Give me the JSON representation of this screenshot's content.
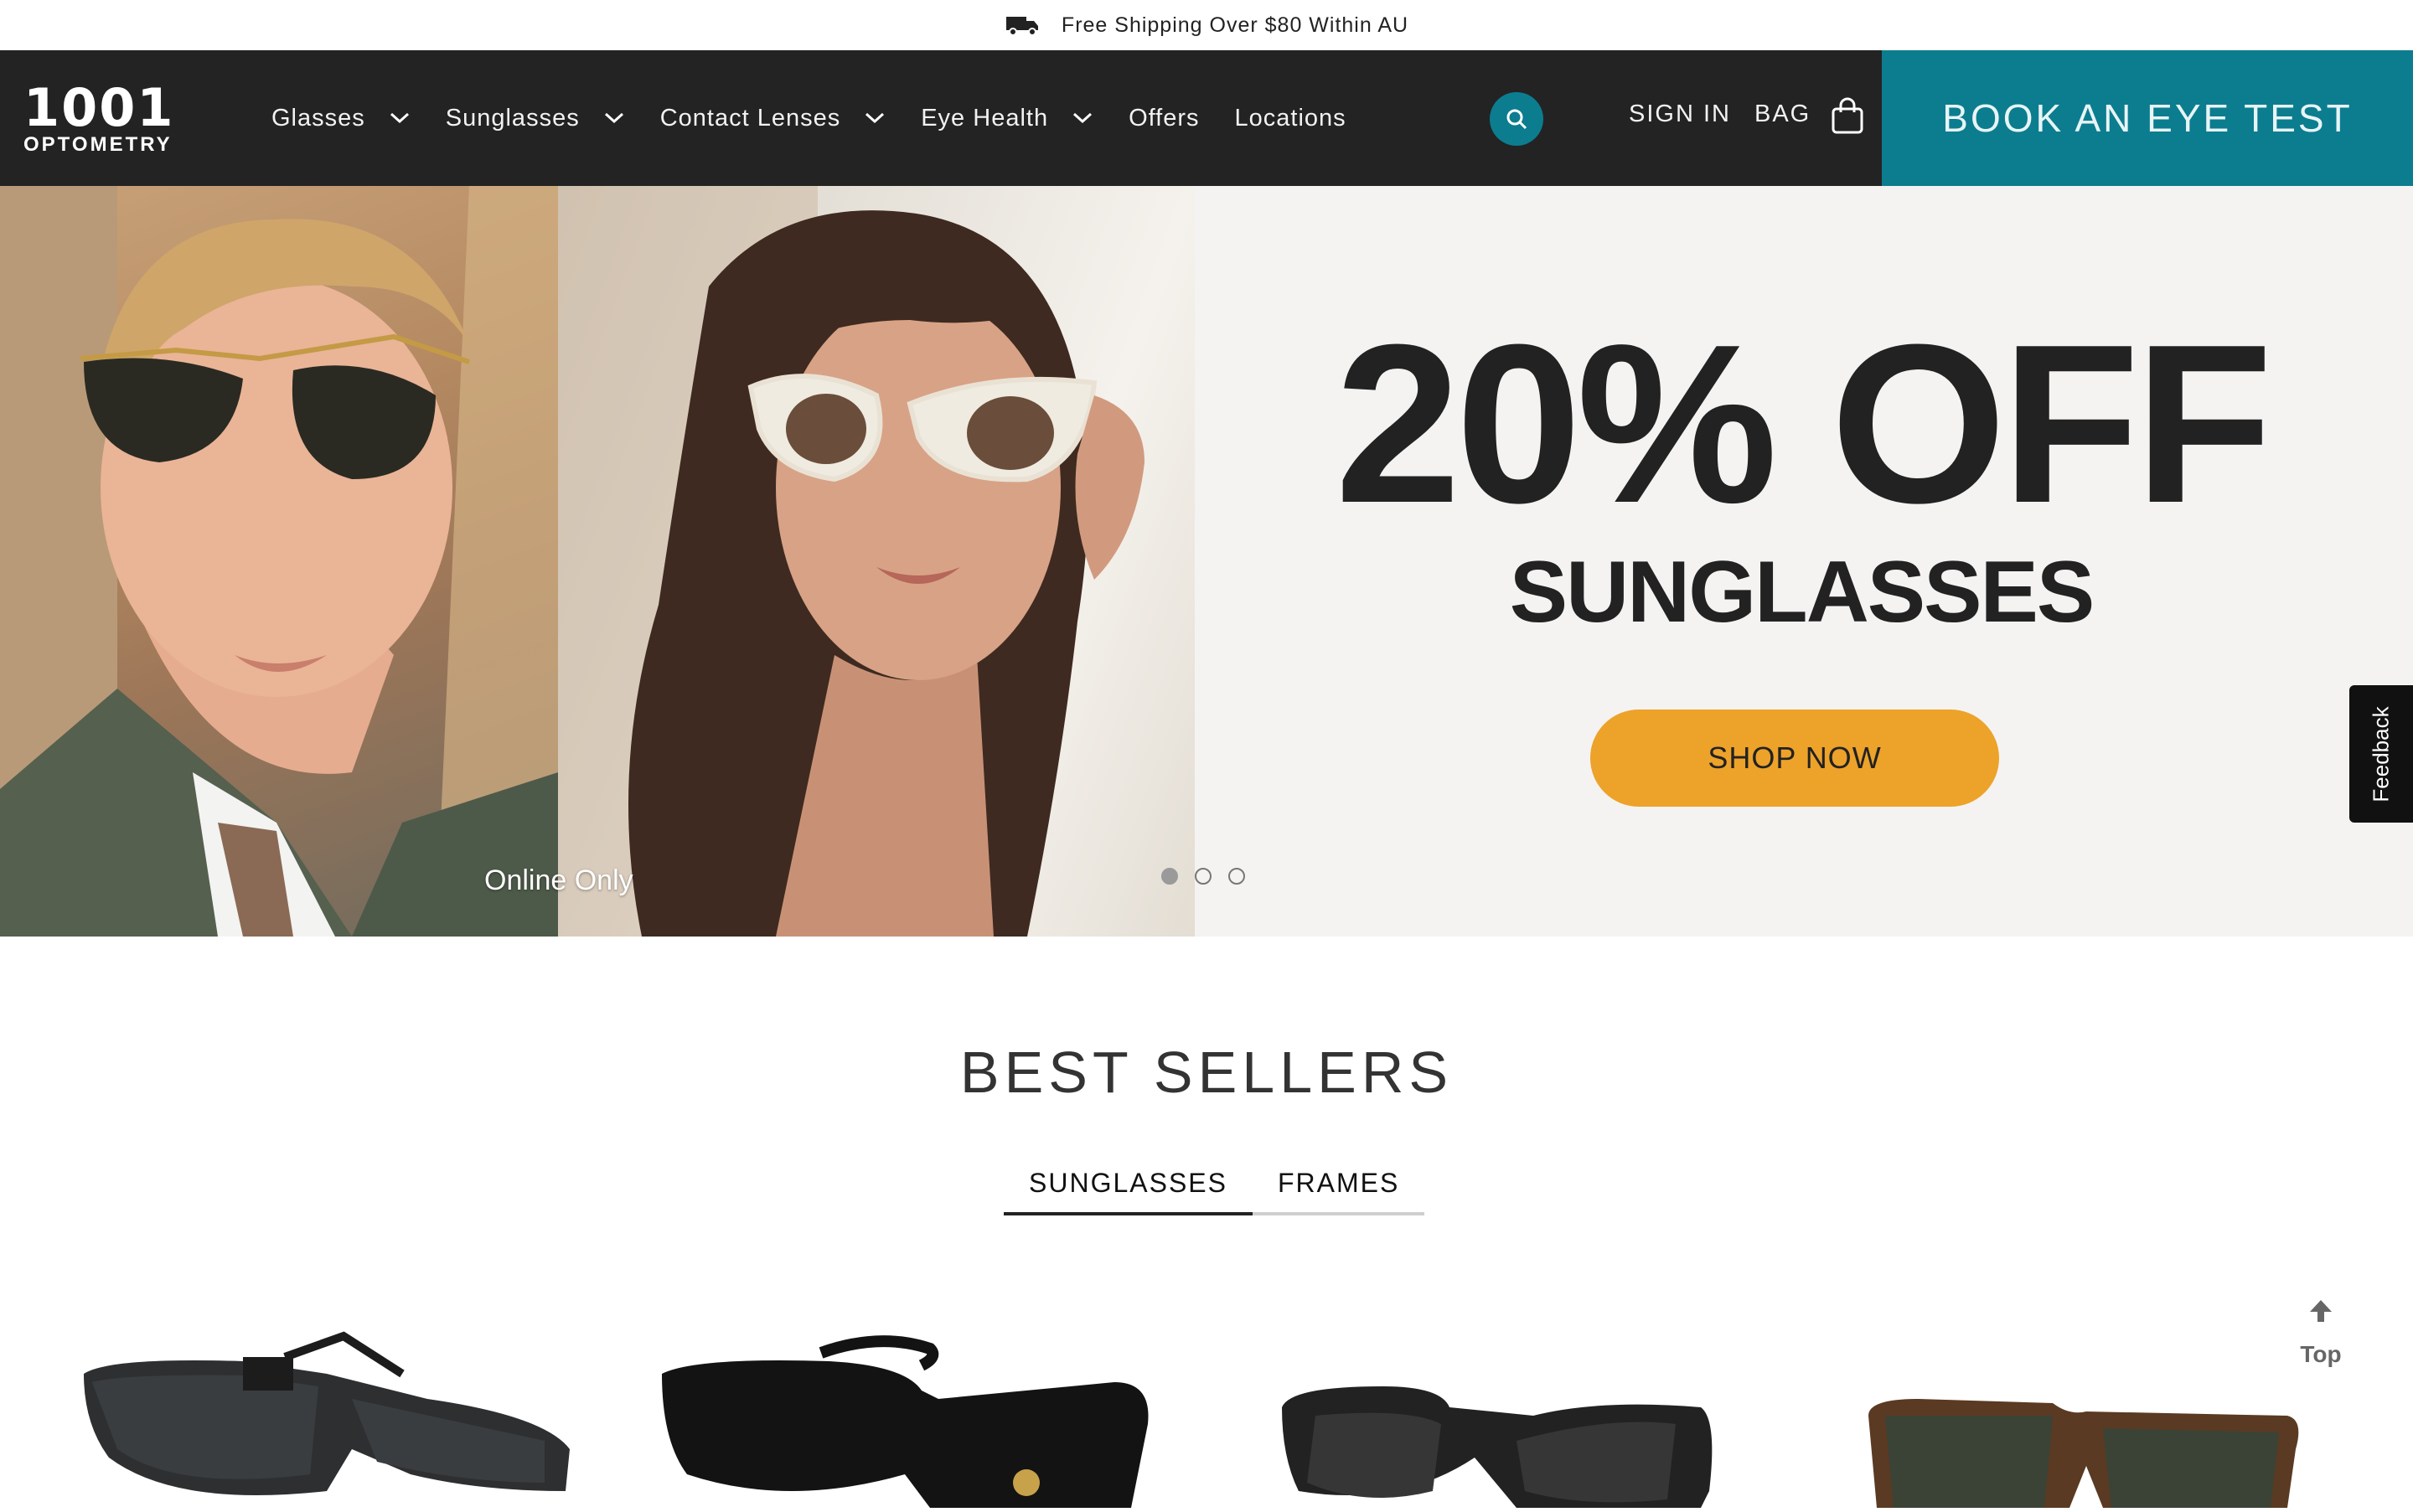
{
  "announcement": {
    "text": "Free Shipping Over $80 Within AU",
    "icon": "truck-icon"
  },
  "header": {
    "logo": {
      "number": "1001",
      "word": "OPTOMETRY"
    },
    "nav": [
      {
        "label": "Glasses",
        "has_dropdown": true
      },
      {
        "label": "Sunglasses",
        "has_dropdown": true
      },
      {
        "label": "Contact Lenses",
        "has_dropdown": true
      },
      {
        "label": "Eye Health",
        "has_dropdown": true
      },
      {
        "label": "Offers",
        "has_dropdown": false
      },
      {
        "label": "Locations",
        "has_dropdown": false
      }
    ],
    "sign_in": "SIGN IN",
    "bag": "BAG",
    "book_button": "BOOK AN EYE TEST",
    "accent_color": "#0b7d8f",
    "background_color": "#232323"
  },
  "hero": {
    "online_only": "Online Only",
    "headline": "20% OFF",
    "subhead": "SUNGLASSES",
    "cta": "SHOP NOW",
    "cta_color": "#eda22a",
    "slides_total": 3,
    "active_slide": 1
  },
  "feedback": {
    "label": "Feedback"
  },
  "best_sellers": {
    "title": "BEST SELLERS",
    "tabs": [
      {
        "label": "SUNGLASSES",
        "active": true
      },
      {
        "label": "FRAMES",
        "active": false
      }
    ]
  },
  "back_to_top": {
    "label": "Top"
  }
}
